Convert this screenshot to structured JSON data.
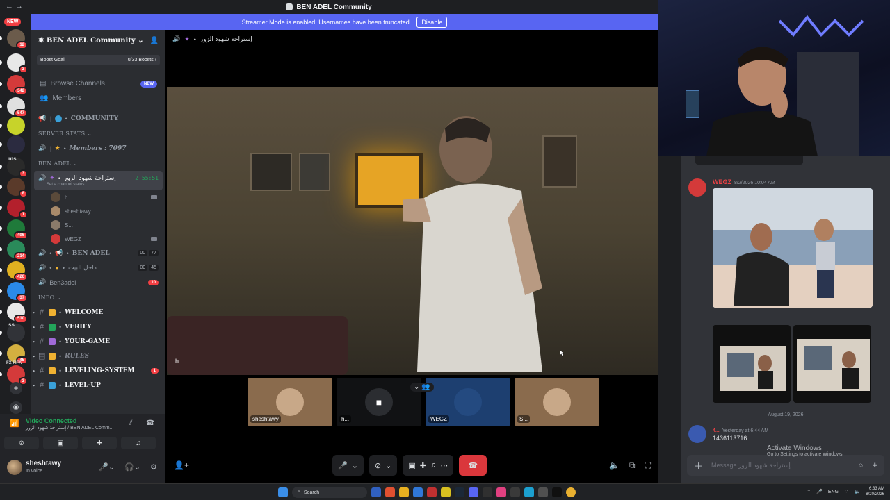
{
  "titlebar": {
    "title": "BEN ADEL Community"
  },
  "banner": {
    "text": "Streamer Mode is enabled. Usernames have been truncated.",
    "disable_label": "Disable"
  },
  "rail": {
    "new_label": "NEW",
    "servers": [
      {
        "badge": "12",
        "color": "#6b5b4b"
      },
      {
        "badge": "3",
        "color": "#e8e8e8"
      },
      {
        "badge": "342",
        "color": "#d43a3a"
      },
      {
        "badge": "547",
        "color": "#e0e0e0"
      },
      {
        "badge": "",
        "color": "#c7d32a"
      },
      {
        "badge": "",
        "color": "#2b2b40"
      },
      {
        "badge": "3",
        "color": "#2a2a2a"
      },
      {
        "badge": "8",
        "color": "#5a3a2a"
      },
      {
        "badge": "1",
        "color": "#b3202c"
      },
      {
        "badge": "496",
        "color": "#1f7a3a"
      },
      {
        "badge": "214",
        "color": "#2a8a5a"
      },
      {
        "badge": "426",
        "color": "#e0b020"
      },
      {
        "badge": "37",
        "color": "#2a8ae8"
      },
      {
        "badge": "510",
        "color": "#e8e8e8"
      },
      {
        "badge": "",
        "color": "#313338"
      },
      {
        "badge": "45",
        "color": "#d4b040"
      },
      {
        "badge": "3",
        "color": "#d43a3a"
      }
    ],
    "labels": {
      "ms": "ms",
      "ss": "ss",
      "fx": "FX FIFA"
    }
  },
  "sidebar": {
    "server_name": "BEN ADEL Community",
    "boost_goal": "Boost Goal",
    "boost_count": "0/33 Boosts",
    "browse_channels": "Browse Channels",
    "new_badge": "NEW",
    "members": "Members",
    "community_channel": "COMMUNITY",
    "server_stats_cat": "SERVER STATS",
    "members_stat": "Members : 7097",
    "ben_adel_cat": "BEN ADEL",
    "active_channel": "إستراحة شهود الزور",
    "active_timer": "2:55:51",
    "channel_status": "Set a channel status",
    "voice_users": [
      "h...",
      "sheshtawy",
      "S...",
      "WEGZ"
    ],
    "ben_adel_channel": "BEN ADEL",
    "ben_adel_counts": [
      "00",
      "77"
    ],
    "second_voice": "داخل البيت",
    "second_voice_counts": [
      "00",
      "45"
    ],
    "ben3adel": "Ben3adel",
    "ben3adel_badge": "10",
    "info_cat": "INFO",
    "info_channels": [
      {
        "name": "WELCOME",
        "style": "serif",
        "badge": ""
      },
      {
        "name": "VERIFY",
        "style": "serif",
        "badge": ""
      },
      {
        "name": "YOUR-GAME",
        "style": "serif",
        "badge": ""
      },
      {
        "name": "RULES",
        "style": "italic",
        "badge": ""
      },
      {
        "name": "LEVELING-SYSTEM",
        "style": "serif",
        "badge": "1"
      },
      {
        "name": "LEVEL-UP",
        "style": "serif",
        "badge": ""
      }
    ]
  },
  "voice_panel": {
    "status": "Video Connected",
    "location": "إستراحة شهود الزور / BEN ADEL Comm..."
  },
  "user_panel": {
    "name": "sheshtawy",
    "status": "In voice"
  },
  "main": {
    "channel_name": "إستراحة شهود الزور",
    "stream_label": "h...",
    "tiles": [
      {
        "label": "sheshtawy",
        "bg": "#8a6b4d"
      },
      {
        "label": "h...",
        "bg": "#111214"
      },
      {
        "label": "WEGZ",
        "bg": "#1d3f70"
      },
      {
        "label": "S...",
        "bg": "#8a6b4d"
      }
    ]
  },
  "chat": {
    "msg1_author": "WEGZ",
    "msg1_time": "8/2/2026 10:04 AM",
    "date_divider": "August 19, 2026",
    "msg2_author": "4...",
    "msg2_time": "Yesterday at 6:44 AM",
    "msg2_text": "1436113716",
    "input_placeholder": "Message إستراحة شهود الزور"
  },
  "watermark": {
    "line1": "Activate Windows",
    "line2": "Go to Settings to activate Windows."
  },
  "taskbar": {
    "search": "Search",
    "lang": "ENG",
    "time": "6:33 AM",
    "date": "8/20/2026"
  }
}
